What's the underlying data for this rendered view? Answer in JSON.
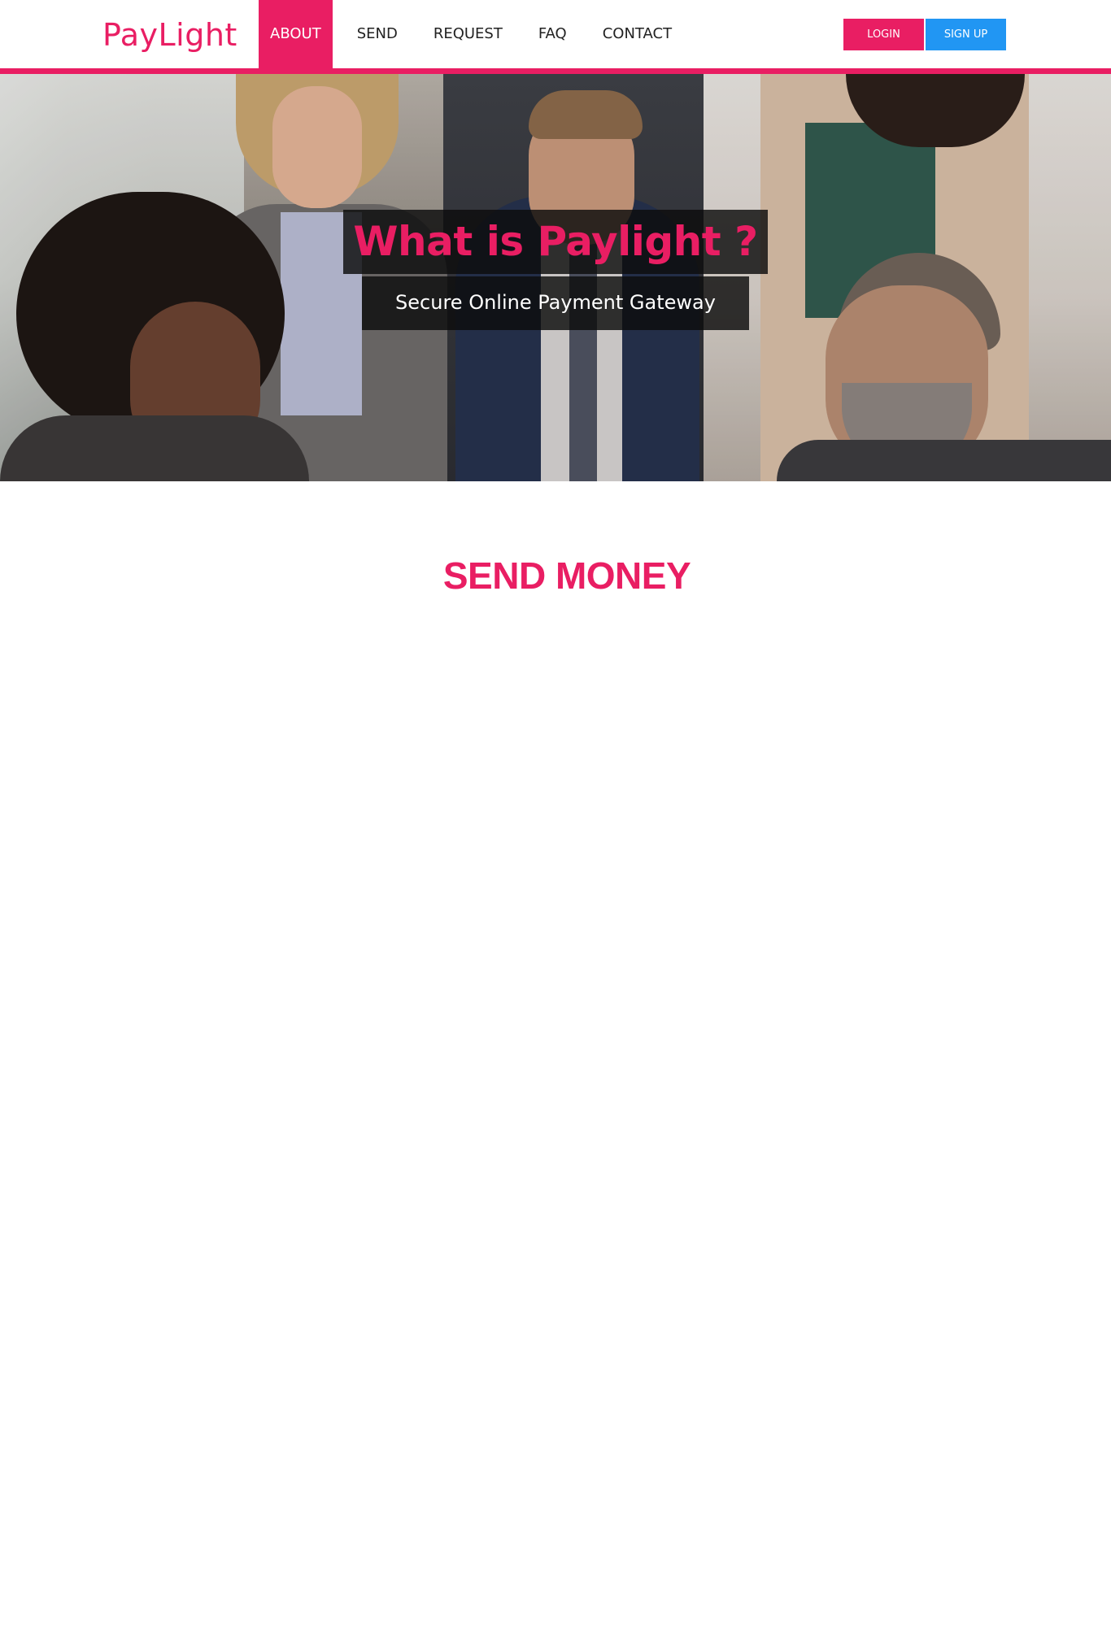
{
  "brand": {
    "name": "PayLight"
  },
  "nav": {
    "items": [
      {
        "label": "ABOUT",
        "active": true
      },
      {
        "label": "SEND"
      },
      {
        "label": "REQUEST"
      },
      {
        "label": "FAQ"
      },
      {
        "label": "CONTACT"
      }
    ]
  },
  "auth": {
    "login_label": "LOGIN",
    "signup_label": "SIGN UP"
  },
  "hero": {
    "title": "What is Paylight ?",
    "subtitle": "Secure Online Payment Gateway",
    "image": "business-team-photo"
  },
  "section": {
    "title": "SEND MONEY"
  },
  "colors": {
    "accent": "#e91e63",
    "secondary": "#2196f3",
    "text": "#222222",
    "background": "#ffffff"
  }
}
